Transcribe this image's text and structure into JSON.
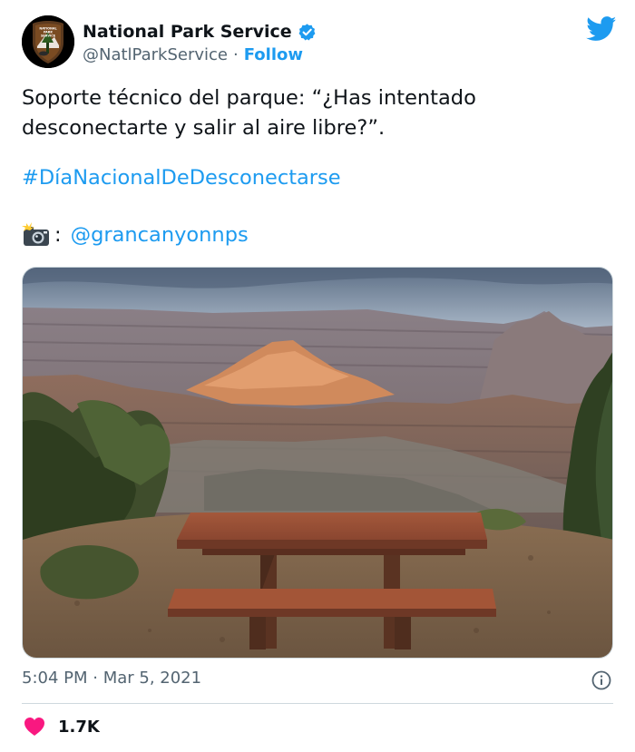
{
  "author": {
    "display_name": "National Park Service",
    "handle": "@NatlParkService",
    "follow_label": "Follow",
    "verified": true,
    "logo_text": [
      "NATIONAL",
      "PARK",
      "SERVICE"
    ]
  },
  "tweet": {
    "text": "Soporte técnico del parque: “¿Has intentado desconectarte y salir al aire libre?”.",
    "hashtag": "#DíaNacionalDeDesconectarse",
    "credit_separator": ":",
    "mention": "@grancanyonnps",
    "timestamp": "5:04 PM · Mar 5, 2021",
    "likes": "1.7K"
  },
  "icons": {
    "verified": "verified-badge-icon",
    "brand": "twitter-bird-icon",
    "camera": "camera-flash-icon",
    "info": "info-icon",
    "like": "heart-icon"
  },
  "colors": {
    "accent": "#1d9bf0",
    "secondary_text": "#536471",
    "like": "#f91880",
    "border": "#cfd9de"
  }
}
